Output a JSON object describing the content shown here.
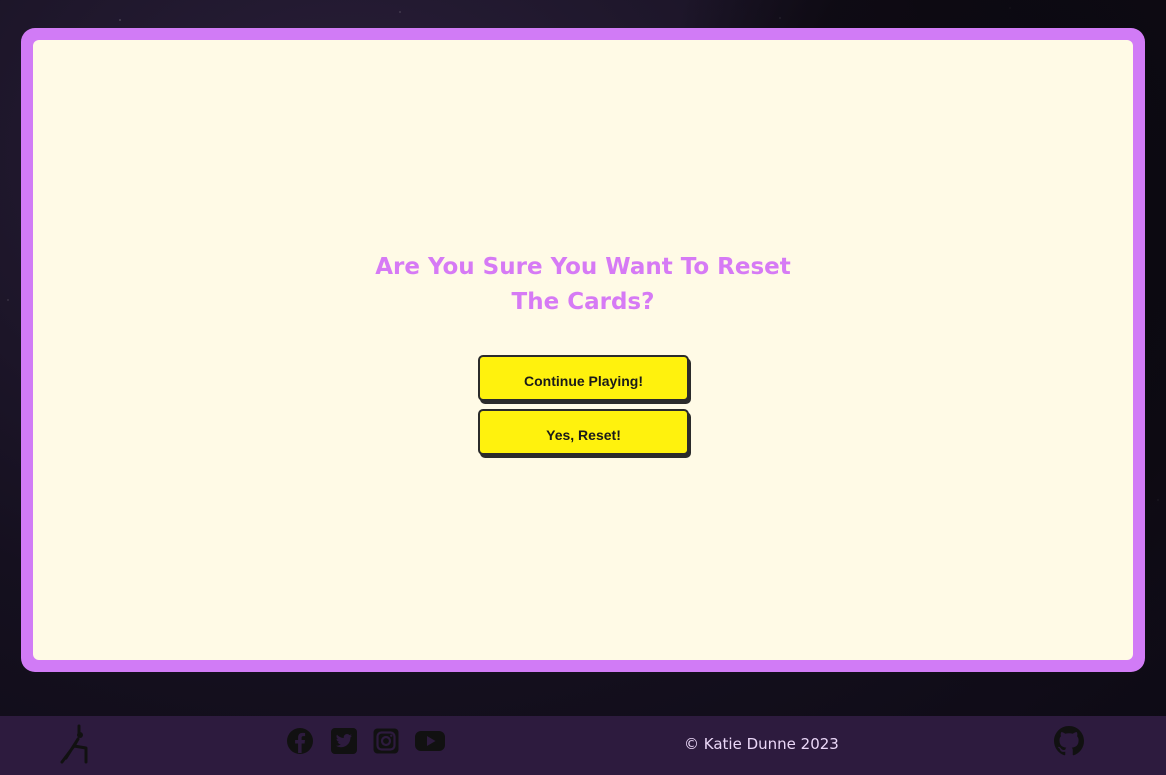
{
  "modal": {
    "title": "Are You Sure You Want To Reset The Cards?",
    "continue_label": "Continue Playing!",
    "reset_label": "Yes, Reset!"
  },
  "footer": {
    "copyright": "© Katie Dunne 2023",
    "social_icons": [
      "facebook-icon",
      "twitter-icon",
      "instagram-icon",
      "youtube-icon"
    ],
    "github_icon": "github-icon",
    "logo_icon": "yoga-pose-icon"
  },
  "colors": {
    "modal_border": "#d17bf6",
    "modal_background": "#fffae6",
    "title": "#d67af5",
    "button": "#fff20d",
    "footer_background": "#2d1b3e"
  }
}
